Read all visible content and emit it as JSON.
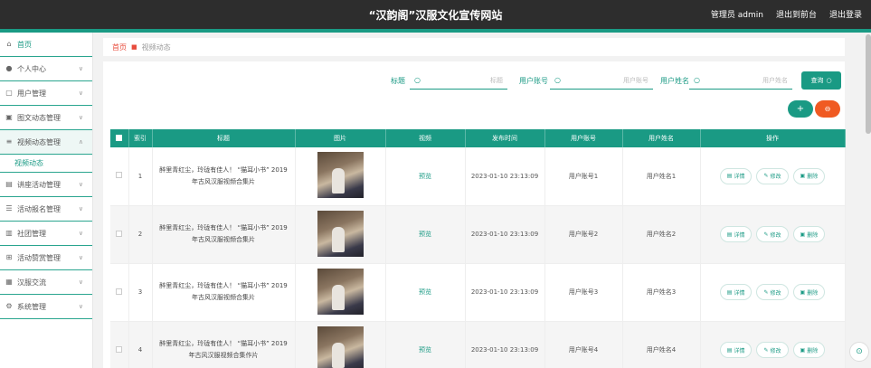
{
  "header": {
    "title": "“汉韵阁”汉服文化宣传网站",
    "user": "管理员 admin",
    "exit_to_front": "退出到前台",
    "logout": "退出登录"
  },
  "sidebar": {
    "items": [
      {
        "label": "首页",
        "icon": "home-icon"
      },
      {
        "label": "个人中心",
        "icon": "user-icon"
      },
      {
        "label": "用户管理",
        "icon": "users-icon"
      },
      {
        "label": "图文动态管理",
        "icon": "news-icon"
      },
      {
        "label": "视频动态管理",
        "icon": "video-icon"
      },
      {
        "label": "视频动态",
        "icon": ""
      },
      {
        "label": "讲座活动管理",
        "icon": "lecture-icon"
      },
      {
        "label": "活动报名管理",
        "icon": "signup-icon"
      },
      {
        "label": "社团管理",
        "icon": "club-icon"
      },
      {
        "label": "活动赞赏管理",
        "icon": "reward-icon"
      },
      {
        "label": "汉服交流",
        "icon": "chat-icon"
      },
      {
        "label": "系统管理",
        "icon": "system-icon"
      }
    ]
  },
  "breadcrumb": {
    "home": "首页",
    "current": "视频动态"
  },
  "search": {
    "title_label": "标题",
    "title_placeholder": "标题",
    "account_label": "用户账号",
    "account_placeholder": "用户账号",
    "name_label": "用户姓名",
    "name_placeholder": "用户姓名",
    "query_button": "查询"
  },
  "actions": {
    "add": "+",
    "delete": "⊖"
  },
  "table": {
    "headers": [
      "索引",
      "标题",
      "图片",
      "视频",
      "发布时间",
      "用户账号",
      "用户姓名",
      "操作"
    ],
    "ops": {
      "detail": "详情",
      "edit": "修改",
      "delete": "删除"
    },
    "rows": [
      {
        "index": "1",
        "title": "醉里青红尘，玲珑有佳人！ “猫耳小书” 2019年古风汉服视频合集片",
        "video": "预览",
        "time": "2023-01-10 23:13:09",
        "account": "用户账号1",
        "name": "用户姓名1"
      },
      {
        "index": "2",
        "title": "醉里青红尘，玲珑有佳人！ “猫耳小书” 2019年古风汉服视频合集片",
        "video": "预览",
        "time": "2023-01-10 23:13:09",
        "account": "用户账号2",
        "name": "用户姓名2"
      },
      {
        "index": "3",
        "title": "醉里青红尘，玲珑有佳人！ “猫耳小书” 2019年古风汉服视频合集片",
        "video": "预览",
        "time": "2023-01-10 23:13:09",
        "account": "用户账号3",
        "name": "用户姓名3"
      },
      {
        "index": "4",
        "title": "醉里青红尘，玲珑有佳人！ “猫耳小书” 2019年古风汉服视频合集作片",
        "video": "预览",
        "time": "2023-01-10 23:13:09",
        "account": "用户账号4",
        "name": "用户姓名4"
      }
    ]
  },
  "colors": {
    "accent": "#1a9a84",
    "danger": "#f05a22",
    "topbar": "#2d2d2d"
  }
}
